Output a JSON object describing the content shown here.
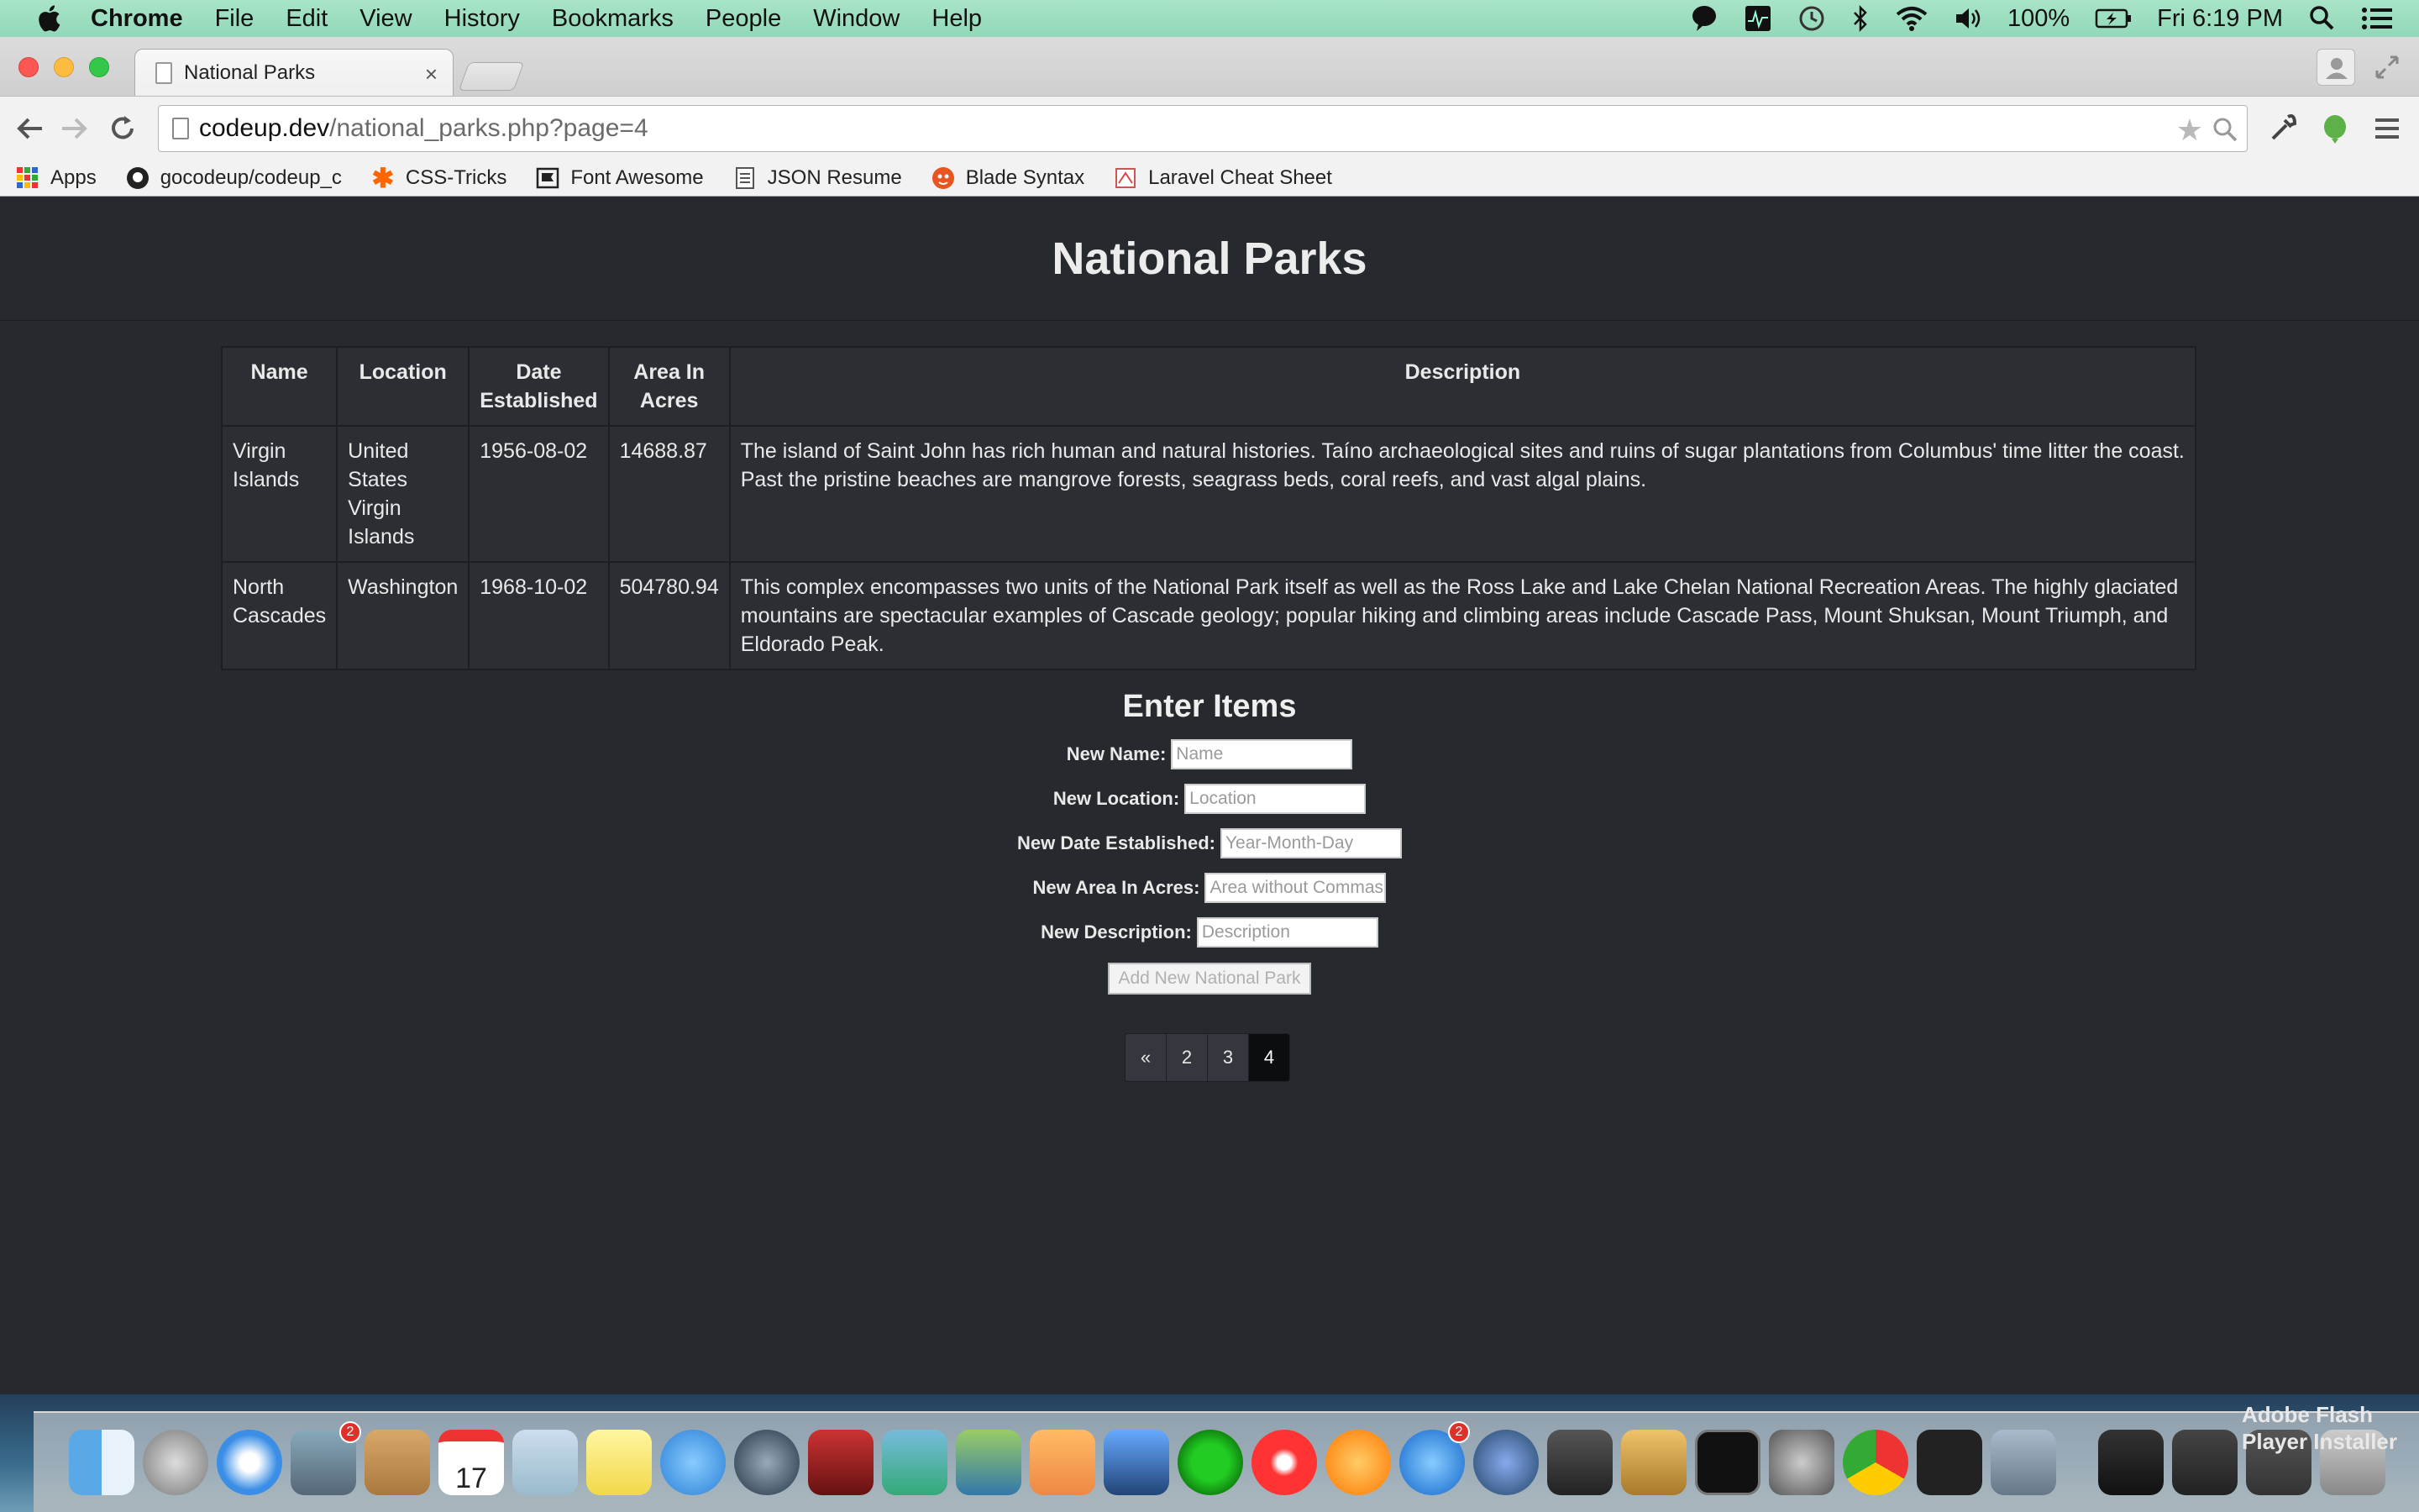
{
  "menubar": {
    "app_name": "Chrome",
    "items": [
      "File",
      "Edit",
      "View",
      "History",
      "Bookmarks",
      "People",
      "Window",
      "Help"
    ],
    "battery": "100%",
    "clock": "Fri 6:19 PM"
  },
  "browser": {
    "tab_title": "National Parks",
    "tab_close": "×",
    "url_host": "codeup.dev",
    "url_path": "/national_parks.php?page=4",
    "star": "★"
  },
  "bookmarks": [
    {
      "label": "Apps",
      "icon": "apps-grid-icon"
    },
    {
      "label": "gocodeup/codeup_c",
      "icon": "github-icon"
    },
    {
      "label": "CSS-Tricks",
      "icon": "css-tricks-icon"
    },
    {
      "label": "Font Awesome",
      "icon": "flag-icon"
    },
    {
      "label": "JSON Resume",
      "icon": "document-icon"
    },
    {
      "label": "Blade Syntax",
      "icon": "laravel-icon"
    },
    {
      "label": "Laravel Cheat Sheet",
      "icon": "laravel-sheet-icon"
    }
  ],
  "page": {
    "title": "National Parks",
    "table": {
      "headers": [
        "Name",
        "Location",
        "Date Established",
        "Area In Acres",
        "Description"
      ],
      "rows": [
        {
          "name": "Virgin Islands",
          "location": "United States Virgin Islands",
          "date": "1956-08-02",
          "area": "14688.87",
          "description": "The island of Saint John has rich human and natural histories. Taíno archaeological sites and ruins of sugar plantations from Columbus' time litter the coast. Past the pristine beaches are mangrove forests, seagrass beds, coral reefs, and vast algal plains."
        },
        {
          "name": "North Cascades",
          "location": "Washington",
          "date": "1968-10-02",
          "area": "504780.94",
          "description": "This complex encompasses two units of the National Park itself as well as the Ross Lake and Lake Chelan National Recreation Areas. The highly glaciated mountains are spectacular examples of Cascade geology; popular hiking and climbing areas include Cascade Pass, Mount Shuksan, Mount Triumph, and Eldorado Peak."
        }
      ]
    },
    "form": {
      "heading": "Enter Items",
      "fields": [
        {
          "label": "New Name:",
          "placeholder": "Name"
        },
        {
          "label": "New Location:",
          "placeholder": "Location"
        },
        {
          "label": "New Date Established:",
          "placeholder": "Year-Month-Day"
        },
        {
          "label": "New Area In Acres:",
          "placeholder": "Area without Commas"
        },
        {
          "label": "New Description:",
          "placeholder": "Description"
        }
      ],
      "submit_label": "Add New National Park"
    },
    "pagination": {
      "prev": "«",
      "pages": [
        "2",
        "3",
        "4"
      ],
      "active_page": "4"
    }
  },
  "dock": {
    "mail_badge": "2",
    "calendar_date": "17",
    "appstore_badge": "2",
    "flash_label_line1": "Adobe Flash",
    "flash_label_line2": "Player Installer"
  },
  "colors": {
    "page_bg": "#26292d",
    "menubar": "#a8e4c8",
    "active_page": "#0c0d0f"
  }
}
